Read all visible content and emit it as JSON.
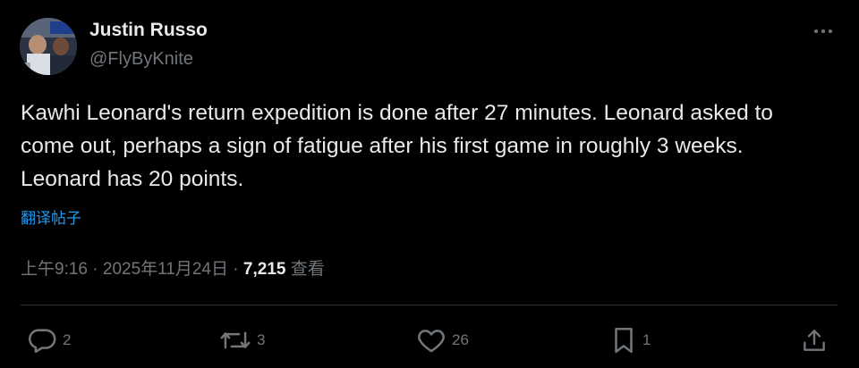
{
  "user": {
    "display_name": "Justin Russo",
    "handle": "@FlyByKnite",
    "avatar_icon": "profile-photo"
  },
  "tweet": {
    "text": "Kawhi Leonard's return expedition is done after 27 minutes. Leonard asked to come out, perhaps a sign of fatigue after his first game in roughly 3 weeks. Leonard has 20 points.",
    "translate_label": "翻译帖子",
    "time": "上午9:16",
    "separator": "·",
    "date": "2025年11月24日",
    "views": "7,215",
    "views_label": "查看"
  },
  "actions": {
    "replies": "2",
    "reposts": "3",
    "likes": "26",
    "bookmarks": "1"
  },
  "colors": {
    "background": "#000000",
    "text": "#e7e9ea",
    "secondary": "#71767b",
    "link": "#1d9bf0",
    "divider": "#2f3336"
  }
}
